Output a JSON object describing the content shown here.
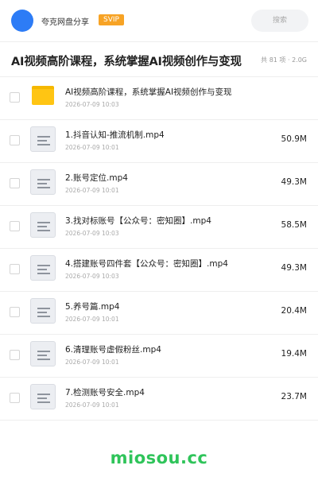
{
  "header": {
    "user_name": "夸克网盘分享",
    "badge": "SVIP",
    "search_placeholder": "搜索"
  },
  "folder": {
    "title": "AI视频高阶课程，系统掌握AI视频创作与变现",
    "summary": "共 81 项 · 2.0G"
  },
  "items": [
    {
      "type": "folder",
      "name": "AI视频高阶课程，系统掌握AI视频创作与变现",
      "date": "2026-07-09 10:03",
      "size": ""
    },
    {
      "type": "video",
      "name": "1.抖音认知-推流机制.mp4",
      "date": "2026-07-09 10:01",
      "size": "50.9M"
    },
    {
      "type": "video",
      "name": "2.账号定位.mp4",
      "date": "2026-07-09 10:01",
      "size": "49.3M"
    },
    {
      "type": "video",
      "name": "3.找对标账号【公众号：密知圈】.mp4",
      "date": "2026-07-09 10:03",
      "size": "58.5M"
    },
    {
      "type": "video",
      "name": "4.搭建账号四件套【公众号：密知圈】.mp4",
      "date": "2026-07-09 10:03",
      "size": "49.3M"
    },
    {
      "type": "video",
      "name": "5.养号篇.mp4",
      "date": "2026-07-09 10:01",
      "size": "20.4M"
    },
    {
      "type": "video",
      "name": "6.清理账号虚假粉丝.mp4",
      "date": "2026-07-09 10:01",
      "size": "19.4M"
    },
    {
      "type": "video",
      "name": "7.检测账号安全.mp4",
      "date": "2026-07-09 10:01",
      "size": "23.7M"
    }
  ],
  "watermark": "miosou.cc"
}
